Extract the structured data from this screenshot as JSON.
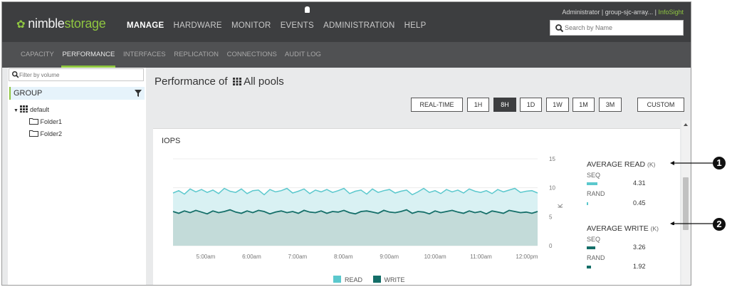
{
  "brand": {
    "name_part1": "nimble",
    "name_part2": "storage"
  },
  "main_nav": [
    "MANAGE",
    "HARDWARE",
    "MONITOR",
    "EVENTS",
    "ADMINISTRATION",
    "HELP"
  ],
  "active_main_nav": "MANAGE",
  "user_line": {
    "user": "Administrator",
    "sep": "|",
    "group": "group-sjc-array...",
    "sep2": "|",
    "infosight": "InfoSight"
  },
  "search": {
    "placeholder": "Search by Name"
  },
  "sub_nav": [
    "CAPACITY",
    "PERFORMANCE",
    "INTERFACES",
    "REPLICATION",
    "CONNECTIONS",
    "AUDIT LOG"
  ],
  "active_sub_nav": "PERFORMANCE",
  "sidebar": {
    "filter_placeholder": "Filter by volume",
    "group_label": "GROUP",
    "tree": [
      "default",
      "Folder1",
      "Folder2"
    ]
  },
  "page": {
    "title_prefix": "Performance of",
    "title_pool": "All pools"
  },
  "time_ranges": [
    "REAL-TIME",
    "1H",
    "8H",
    "1D",
    "1W",
    "1M",
    "3M",
    "CUSTOM"
  ],
  "active_time_range": "8H",
  "card": {
    "title": "IOPS",
    "avg_read": {
      "label": "AVERAGE READ",
      "unit": "(K)",
      "seq_label": "SEQ",
      "seq_value": "4.31",
      "rand_label": "RAND",
      "rand_value": "0.45"
    },
    "avg_write": {
      "label": "AVERAGE WRITE",
      "unit": "(K)",
      "seq_label": "SEQ",
      "seq_value": "3.26",
      "rand_label": "RAND",
      "rand_value": "1.92"
    },
    "legend": {
      "read": "READ",
      "write": "WRITE"
    },
    "axis_symbol": "K"
  },
  "callouts": [
    "1",
    "2"
  ],
  "colors": {
    "read": "#5bc8cd",
    "read_fill": "#d9f1f3",
    "write": "#146e68",
    "write_fill": "#c3dbd9",
    "accent": "#8fc640",
    "topbar": "#3d3e40"
  },
  "chart_data": {
    "type": "area",
    "title": "IOPS",
    "x": [
      "5:00am",
      "6:00am",
      "7:00am",
      "8:00am",
      "9:00am",
      "10:00am",
      "11:00am",
      "12:00pm"
    ],
    "ylabel": "K",
    "yticks": [
      0,
      5,
      10,
      15
    ],
    "ylim": [
      0,
      15
    ],
    "series": [
      {
        "name": "READ",
        "values": [
          9.1,
          9.5,
          8.9,
          9.8,
          9.3,
          9.7,
          9.2,
          9.6,
          9.0,
          9.9,
          9.4,
          9.2,
          9.8,
          9.0,
          9.5,
          9.6,
          8.8,
          9.7,
          9.3,
          9.5,
          9.9,
          9.1,
          9.4,
          9.8,
          9.0,
          9.6,
          9.3,
          9.7,
          9.2,
          9.5,
          9.9,
          9.0,
          9.4,
          9.6,
          8.9,
          9.8,
          9.2,
          9.5,
          9.7,
          9.1,
          9.4,
          9.6,
          8.8,
          9.3,
          9.9,
          9.2,
          9.5,
          9.0,
          9.7,
          9.3,
          9.6,
          9.1,
          9.8,
          9.4,
          9.2,
          9.5,
          9.0,
          9.7,
          9.3,
          9.6,
          9.9,
          9.2,
          9.4,
          9.5,
          9.1
        ]
      },
      {
        "name": "WRITE",
        "values": [
          5.9,
          5.6,
          6.0,
          5.7,
          6.1,
          5.8,
          5.5,
          6.0,
          5.7,
          5.9,
          6.2,
          5.8,
          5.6,
          6.0,
          5.7,
          6.1,
          5.9,
          5.5,
          5.8,
          6.0,
          5.7,
          5.9,
          5.6,
          6.1,
          5.8,
          5.7,
          6.0,
          5.6,
          5.9,
          5.8,
          6.1,
          5.7,
          5.5,
          5.9,
          6.0,
          5.8,
          5.6,
          6.1,
          5.8,
          5.7,
          5.9,
          6.2,
          5.6,
          5.9,
          5.8,
          5.5,
          6.0,
          5.7,
          5.9,
          6.1,
          5.8,
          5.6,
          6.0,
          5.7,
          5.9,
          5.5,
          6.0,
          5.8,
          5.6,
          6.1,
          5.9,
          5.7,
          5.8,
          5.6,
          5.9
        ]
      }
    ],
    "legend": [
      "READ",
      "WRITE"
    ],
    "legend_position": "bottom",
    "grid": true
  }
}
